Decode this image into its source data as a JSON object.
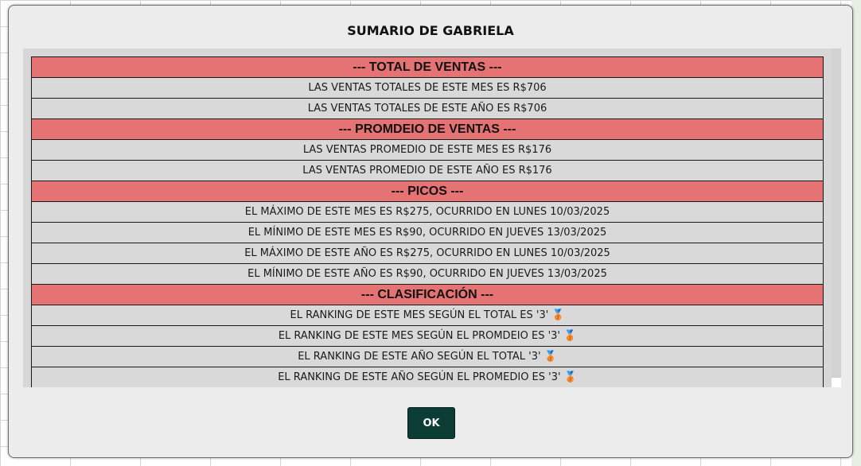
{
  "dialog": {
    "title": "SUMARIO DE GABRIELA",
    "ok_label": "OK"
  },
  "sections": [
    {
      "header": "--- TOTAL DE VENTAS ---",
      "lines": [
        {
          "text": "LAS VENTAS TOTALES DE ESTE MES ES R$706"
        },
        {
          "text": "LAS VENTAS TOTALES DE ESTE AÑO ES R$706"
        }
      ]
    },
    {
      "header": "--- PROMDEIO DE VENTAS ---",
      "lines": [
        {
          "text": "LAS VENTAS PROMEDIO DE ESTE MES ES R$176"
        },
        {
          "text": "LAS VENTAS PROMEDIO DE ESTE AÑO ES R$176"
        }
      ]
    },
    {
      "header": "--- PICOS ---",
      "lines": [
        {
          "text": "EL MÁXIMO DE ESTE MES ES R$275, OCURRIDO EN LUNES 10/03/2025"
        },
        {
          "text": "EL MÍNIMO DE ESTE MES ES R$90, OCURRIDO EN JUEVES 13/03/2025"
        },
        {
          "text": "EL MÁXIMO DE ESTE AÑO ES R$275, OCURRIDO EN LUNES 10/03/2025"
        },
        {
          "text": "EL MÍNIMO DE ESTE AÑO ES R$90, OCURRIDO EN JUEVES 13/03/2025"
        }
      ]
    },
    {
      "header": "--- CLASIFICACIÓN ---",
      "lines": [
        {
          "text": "EL RANKING DE ESTE MES SEGÚN EL TOTAL ES '3'",
          "icon": "medal-icon",
          "glyph": "🥉"
        },
        {
          "text": "EL RANKING DE ESTE MES SEGÚN EL PROMDEIO ES '3'",
          "icon": "medal-icon",
          "glyph": "🥉"
        },
        {
          "text": "EL RANKING DE ESTE AÑO SEGÚN EL TOTAL '3'",
          "icon": "medal-icon",
          "glyph": "🥉"
        },
        {
          "text": "EL RANKING DE ESTE AÑO SEGÚN EL PROMEDIO ES '3'",
          "icon": "medal-icon",
          "glyph": "🥉"
        }
      ]
    }
  ],
  "colors": {
    "header_bg": "#e67373",
    "row_bg": "#d9d9d9",
    "ok_bg": "#0b3d34"
  }
}
